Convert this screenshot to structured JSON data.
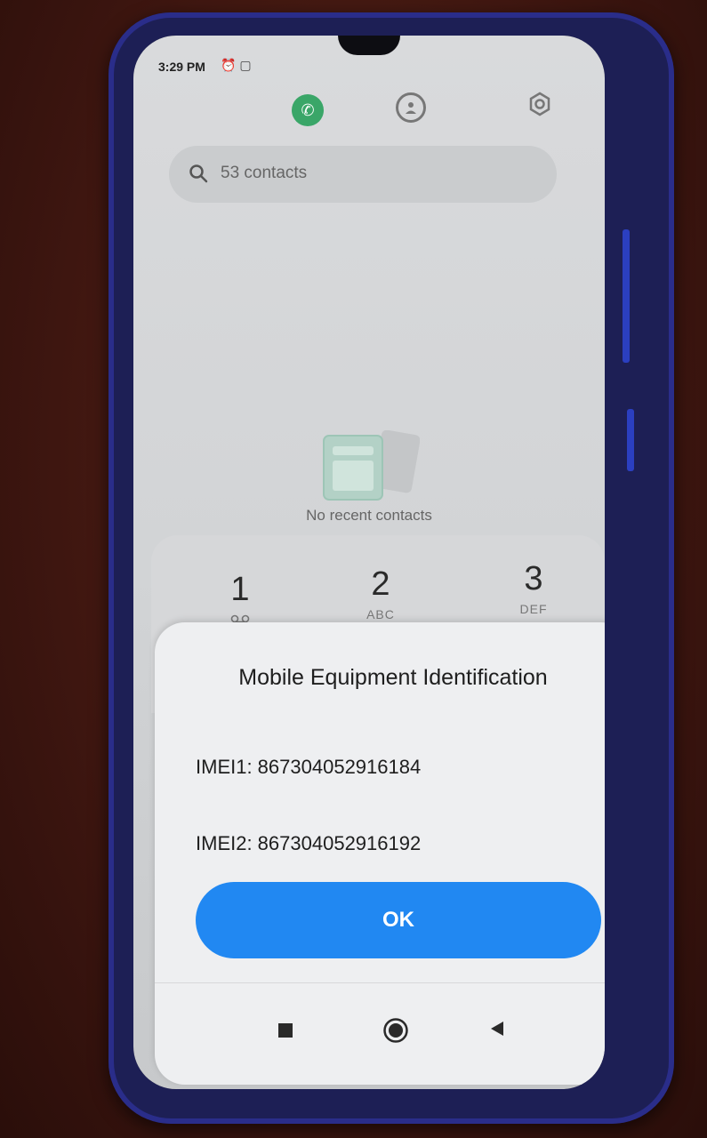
{
  "status_bar": {
    "time": "3:29 PM",
    "icons": [
      "alarm-icon",
      "notification-icon"
    ]
  },
  "top_bar": {
    "icons": [
      "phone-icon",
      "contacts-icon",
      "settings-icon"
    ],
    "accent_color": "#3aa668"
  },
  "search": {
    "placeholder": "53 contacts"
  },
  "empty_state": {
    "text": "No recent contacts"
  },
  "dialpad": {
    "keys": [
      {
        "digit": "1",
        "sub": "voicemail-icon"
      },
      {
        "digit": "2",
        "sub": "ABC"
      },
      {
        "digit": "3",
        "sub": "DEF"
      }
    ]
  },
  "dialog": {
    "title": "Mobile Equipment Identification",
    "imei1": "IMEI1: 867304052916184",
    "imei2": "IMEI2: 867304052916192",
    "ok_label": "OK",
    "button_color": "#2188f2"
  },
  "nav_bar": {
    "icons": [
      "recents-icon",
      "home-icon",
      "back-icon"
    ]
  }
}
